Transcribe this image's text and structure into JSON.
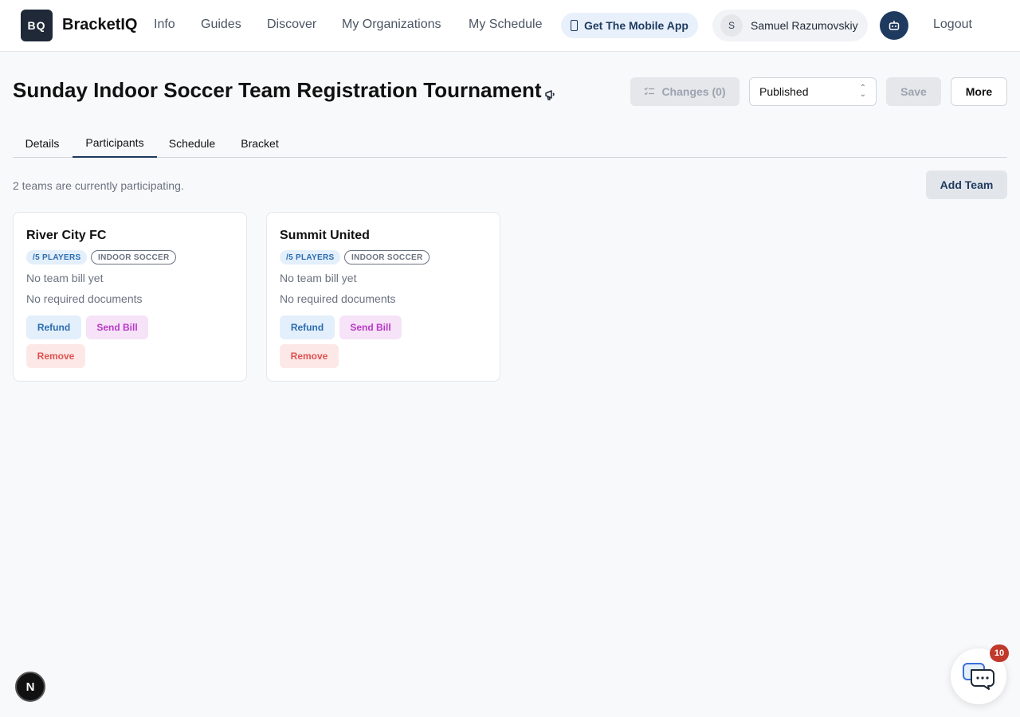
{
  "nav": {
    "logo_text": "BQ",
    "brand": "BracketIQ",
    "links": [
      "Info",
      "Guides",
      "Discover",
      "My Organizations",
      "My Schedule"
    ],
    "mobile_app": "Get The Mobile App",
    "user_initial": "S",
    "user_name": "Samuel Razumovskiy",
    "logout": "Logout"
  },
  "header": {
    "title": "Sunday Indoor Soccer Team Registration Tournament",
    "changes": "Changes (0)",
    "status": "Published",
    "save": "Save",
    "more": "More"
  },
  "tabs": [
    "Details",
    "Participants",
    "Schedule",
    "Bracket"
  ],
  "active_tab": "Participants",
  "participants": {
    "summary": "2 teams are currently participating.",
    "add_team": "Add Team",
    "teams": [
      {
        "name": "River City FC",
        "players_badge": "/5 PLAYERS",
        "sport_badge": "INDOOR SOCCER",
        "bill_status": "No team bill yet",
        "documents": "No required documents",
        "refund": "Refund",
        "send_bill": "Send Bill",
        "remove": "Remove"
      },
      {
        "name": "Summit United",
        "players_badge": "/5 PLAYERS",
        "sport_badge": "INDOOR SOCCER",
        "bill_status": "No team bill yet",
        "documents": "No required documents",
        "refund": "Refund",
        "send_bill": "Send Bill",
        "remove": "Remove"
      }
    ]
  },
  "floating": {
    "dev_badge": "N",
    "chat_unread": "10"
  },
  "colors": {
    "primary": "#1e3a5f",
    "refund": "#2b6cb0",
    "send_bill": "#b839c5",
    "remove": "#e0524f",
    "badge_unread": "#c0392b"
  },
  "icons": [
    "phone-icon",
    "robot-icon",
    "megaphone-icon",
    "checklist-icon",
    "chevron-updown-icon",
    "chat-icon"
  ]
}
